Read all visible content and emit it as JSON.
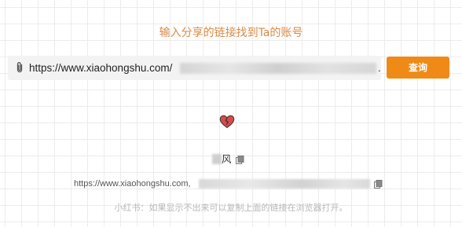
{
  "header": {
    "title": "输入分享的链接找到Ta的账号"
  },
  "search": {
    "value": "https://www.xiaohongshu.com/",
    "trailing_char": ".",
    "button_label": "查询"
  },
  "result": {
    "name": "风",
    "link": "https://www.xiaohongshu.com,",
    "hint": "小红书：如果显示不出来可以复制上面的链接在浏览器打开。"
  },
  "colors": {
    "title": "#d88a45",
    "button": "#f08a16",
    "heart": "#d94a4a",
    "hint": "#b8b8b8"
  },
  "icons": {
    "link": "paperclip-icon",
    "result": "broken-heart-icon",
    "copy": "copy-icon"
  }
}
